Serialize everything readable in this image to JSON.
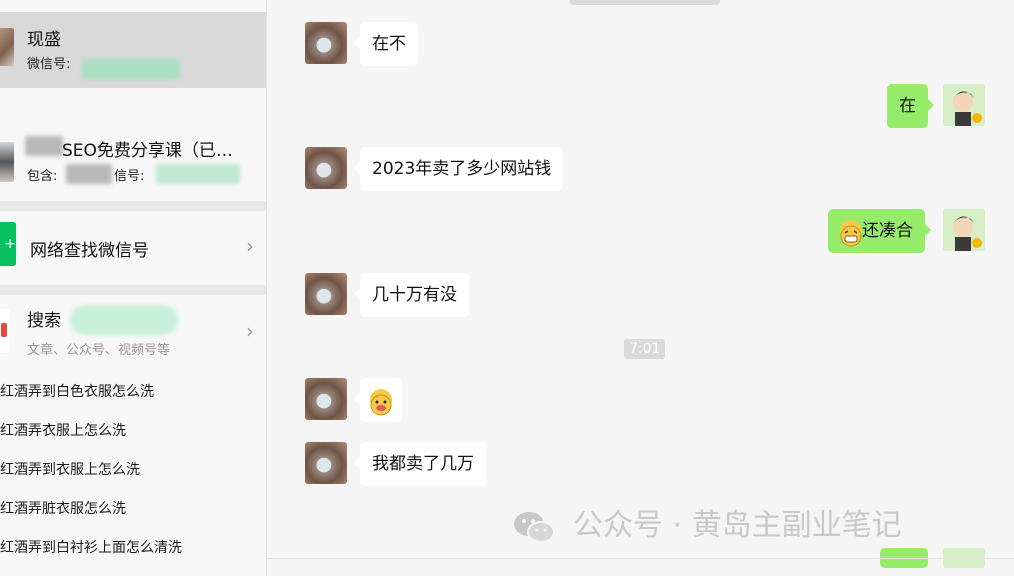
{
  "contacts": [
    {
      "name": "现盛",
      "wechat_label": "微信号:"
    },
    {
      "name": "SEO免费分享课（已…",
      "sub_prefix": "包含:",
      "sub_mid": "信号:"
    }
  ],
  "network_search": {
    "label": "网络查找微信号",
    "icon": "wechat-search-icon"
  },
  "search_section": {
    "label": "搜索",
    "hint": "文章、公众号、视频号等"
  },
  "suggestions": [
    "红酒弄到白色衣服怎么洗",
    "红酒弄衣服上怎么洗",
    "红酒弄到衣服上怎么洗",
    "红酒弄脏衣服怎么洗",
    "红酒弄到白衬衫上面怎么清洗"
  ],
  "messages": [
    {
      "side": "left",
      "text": "在不"
    },
    {
      "side": "right",
      "text": "在"
    },
    {
      "side": "left",
      "text": "2023年卖了多少网站钱"
    },
    {
      "side": "right",
      "text": "还凑合",
      "emoji": "grin-emoji"
    },
    {
      "side": "left",
      "text": "几十万有没"
    },
    {
      "side": "left",
      "text": "",
      "emoji": "drooling-face-emoji"
    },
    {
      "side": "left",
      "text": "我都卖了几万"
    }
  ],
  "time_divider": "7:01",
  "watermark": {
    "text": "公众号 · 黄岛主副业笔记"
  },
  "colors": {
    "green_bubble": "#95ec69",
    "white_bubble": "#ffffff",
    "accent": "#07c160"
  }
}
